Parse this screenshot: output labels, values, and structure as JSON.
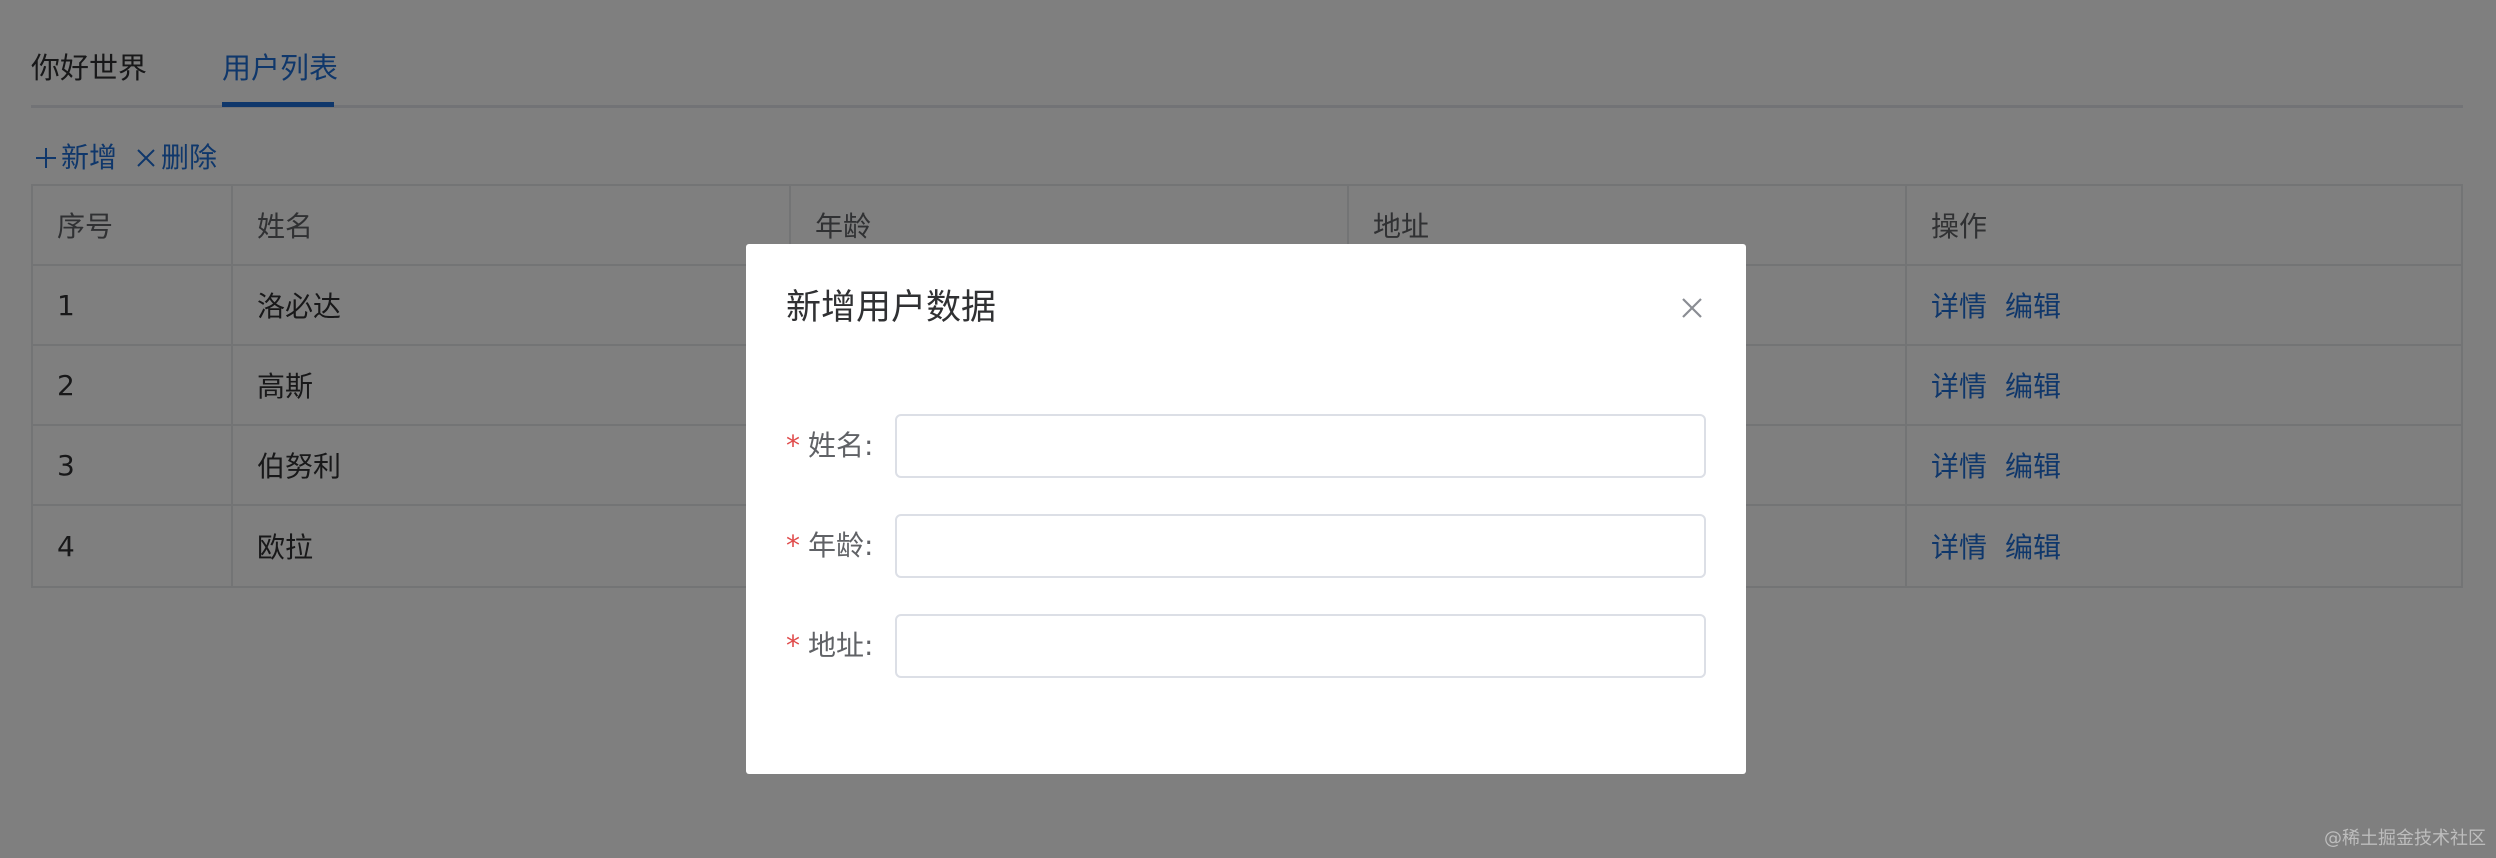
{
  "tabs": [
    {
      "label": "你好世界",
      "active": false
    },
    {
      "label": "用户列表",
      "active": true
    }
  ],
  "toolbar": {
    "add_label": "新增",
    "add_icon": "plus-icon",
    "delete_label": "删除",
    "delete_icon": "close-icon"
  },
  "table": {
    "headers": [
      "序号",
      "姓名",
      "年龄",
      "地址",
      "操作"
    ],
    "rows": [
      {
        "index": "1",
        "name": "洛必达"
      },
      {
        "index": "2",
        "name": "高斯"
      },
      {
        "index": "3",
        "name": "伯努利"
      },
      {
        "index": "4",
        "name": "欧拉"
      }
    ],
    "detail_label": "详情",
    "edit_label": "编辑"
  },
  "dialog": {
    "title": "新增用户数据",
    "close_icon": "close-icon",
    "fields": [
      {
        "label": "姓名:",
        "required": true,
        "value": ""
      },
      {
        "label": "年龄:",
        "required": true,
        "value": ""
      },
      {
        "label": "地址:",
        "required": true,
        "value": ""
      }
    ],
    "required_mark": "*"
  },
  "watermark": "@稀土掘金技术社区",
  "colors": {
    "accent": "#1f6fd6",
    "required": "#e04b4b",
    "overlay": "rgba(0,0,0,0.5)"
  }
}
